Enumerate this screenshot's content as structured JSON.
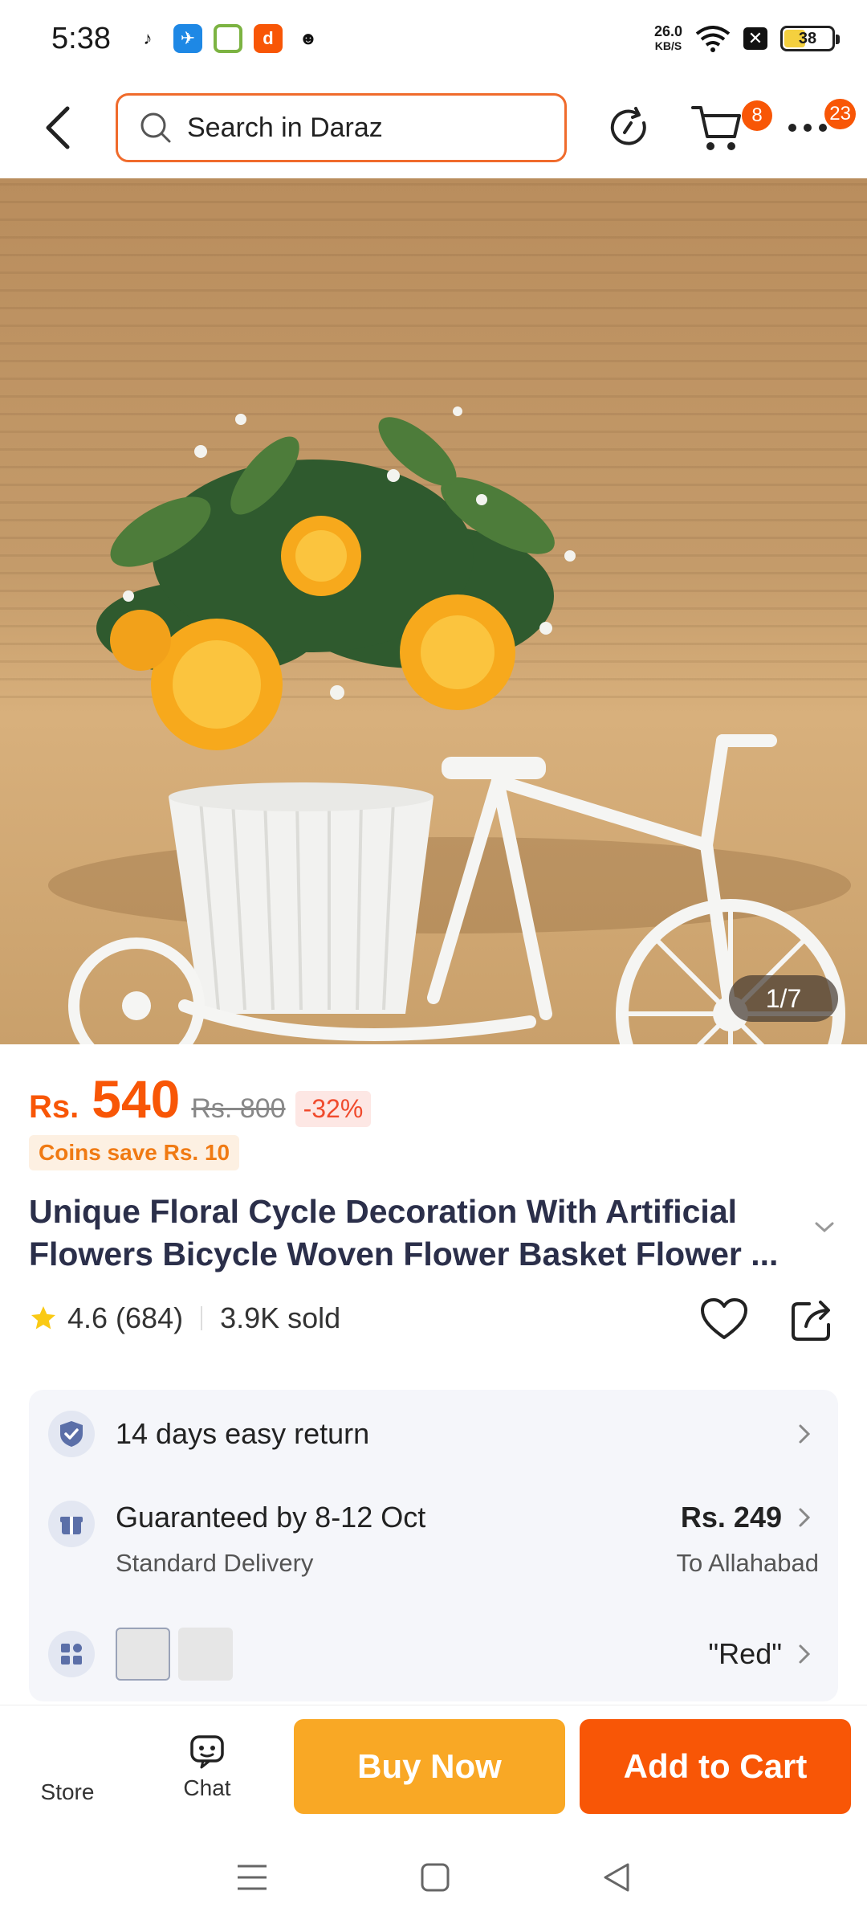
{
  "status": {
    "time": "5:38",
    "net_speed_value": "26.0",
    "net_speed_unit": "KB/S",
    "battery": "38"
  },
  "header": {
    "search_placeholder": "Search in Daraz",
    "cart_count": "8",
    "more_count": "23"
  },
  "gallery": {
    "counter": "1/7"
  },
  "product": {
    "currency": "Rs.",
    "price": "540",
    "old_price": "Rs. 800",
    "discount": "-32%",
    "coins_note": "Coins save Rs. 10",
    "title": "Unique Floral Cycle Decoration With Artificial Flowers Bicycle Woven Flower Basket Flower ...",
    "rating": "4.6",
    "reviews": "(684)",
    "sold": "3.9K sold"
  },
  "info": {
    "returns": "14 days easy return",
    "delivery_title": "Guaranteed by 8-12 Oct",
    "delivery_type": "Standard Delivery",
    "delivery_price": "Rs. 249",
    "delivery_location": "To Allahabad",
    "variant_value": "\"Red\""
  },
  "bottom_bar": {
    "store": "Store",
    "chat": "Chat",
    "buy_now": "Buy Now",
    "add_to_cart": "Add to Cart"
  },
  "colors": {
    "brand_orange": "#f85606",
    "buy_yellow": "#f9a825"
  }
}
